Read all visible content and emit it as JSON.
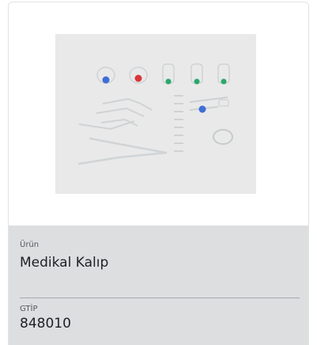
{
  "product": {
    "image_alt": "medical-molded-parts-photo",
    "product_label": "Ürün",
    "product_name": "Medikal Kalıp",
    "code_label": "GTİP",
    "code_value": "848010"
  },
  "colors": {
    "card_bg": "#ffffff",
    "info_bg": "#dcdee0",
    "photo_bg": "#e9e9e9",
    "text_primary": "#1d2125",
    "text_secondary": "#555a5f"
  },
  "icons": [
    "product-photo"
  ]
}
